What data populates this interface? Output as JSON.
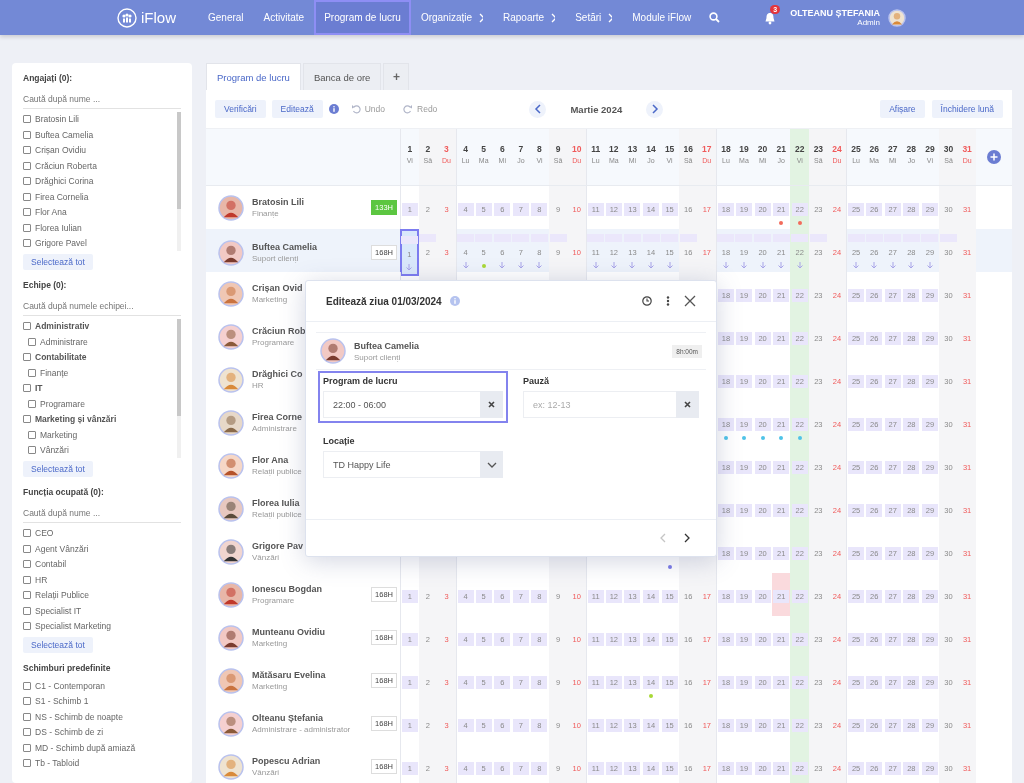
{
  "topbar": {
    "logo": "iFlow",
    "nav": [
      {
        "label": "General",
        "selected": false,
        "submenu": false
      },
      {
        "label": "Activitate",
        "selected": false,
        "submenu": false
      },
      {
        "label": "Program de lucru",
        "selected": true,
        "submenu": false
      },
      {
        "label": "Organizație",
        "selected": false,
        "submenu": true
      },
      {
        "label": "Rapoarte",
        "selected": false,
        "submenu": true
      },
      {
        "label": "Setări",
        "selected": false,
        "submenu": true
      },
      {
        "label": "Module iFlow",
        "selected": false,
        "submenu": false
      }
    ],
    "notifications": "3",
    "user": {
      "name": "OLTEANU ȘTEFANIA",
      "role": "Admin"
    }
  },
  "sidebar": [
    {
      "title": "Angajați (0):",
      "search_placeholder": "Caută după nume ...",
      "scrollable": true,
      "kind": "checklist",
      "select_all": "Selectează tot",
      "items": [
        {
          "label": "Bratosin Lili",
          "checked": false
        },
        {
          "label": "Buftea Camelia",
          "checked": false
        },
        {
          "label": "Crișan Ovidiu",
          "checked": false
        },
        {
          "label": "Crăciun Roberta",
          "checked": false
        },
        {
          "label": "Drăghici Corina",
          "checked": false
        },
        {
          "label": "Firea Cornelia",
          "checked": false
        },
        {
          "label": "Flor Ana",
          "checked": false
        },
        {
          "label": "Florea Iulian",
          "checked": false
        },
        {
          "label": "Grigore Pavel",
          "checked": false
        }
      ]
    },
    {
      "title": "Echipe (0):",
      "search_placeholder": "Caută după numele echipei...",
      "scrollable": true,
      "kind": "tree",
      "select_all": "Selectează tot",
      "items": [
        {
          "label": "Administrativ",
          "checked": false,
          "children": [
            {
              "label": "Administrare",
              "checked": false
            }
          ]
        },
        {
          "label": "Contabilitate",
          "checked": false,
          "children": [
            {
              "label": "Finanțe",
              "checked": false
            }
          ]
        },
        {
          "label": "IT",
          "checked": false,
          "children": [
            {
              "label": "Programare",
              "checked": false
            }
          ]
        },
        {
          "label": "Marketing și vânzări",
          "checked": false,
          "children": [
            {
              "label": "Marketing",
              "checked": false
            },
            {
              "label": "Vânzări",
              "checked": false
            }
          ]
        }
      ]
    },
    {
      "title": "Funcția ocupată (0):",
      "search_placeholder": "Caută după nume ...",
      "scrollable": false,
      "kind": "checklist",
      "select_all": "Selectează tot",
      "items": [
        {
          "label": "CEO",
          "checked": false
        },
        {
          "label": "Agent Vânzări",
          "checked": false
        },
        {
          "label": "Contabil",
          "checked": false
        },
        {
          "label": "HR",
          "checked": false
        },
        {
          "label": "Relații Publice",
          "checked": false
        },
        {
          "label": "Specialist IT",
          "checked": false
        },
        {
          "label": "Specialist Marketing",
          "checked": false
        }
      ]
    },
    {
      "title": "Schimburi predefinite",
      "scrollable": false,
      "kind": "checklist",
      "items": [
        {
          "label": "C1 - Contemporan",
          "checked": false
        },
        {
          "label": "S1 - Schimb 1",
          "checked": false
        },
        {
          "label": "NS - Schimb de noapte",
          "checked": false
        },
        {
          "label": "DS - Schimb de zi",
          "checked": false
        },
        {
          "label": "MD - Schimb după amiază",
          "checked": false
        },
        {
          "label": "Tb - Tabloid",
          "checked": false
        }
      ]
    }
  ],
  "tabs": [
    {
      "label": "Program de lucru",
      "selected": true
    },
    {
      "label": "Banca de ore",
      "selected": false
    }
  ],
  "add_tab": "+",
  "toolbar": {
    "left": [
      {
        "kind": "button",
        "label": "Verificări",
        "disabled": false
      },
      {
        "kind": "button",
        "label": "Editează",
        "disabled": false
      },
      {
        "kind": "info"
      },
      {
        "kind": "undo",
        "label": "Undo",
        "disabled": true
      },
      {
        "kind": "redo",
        "label": "Redo",
        "disabled": true
      }
    ],
    "month": "Martie 2024",
    "right": [
      "Afișare",
      "Închidere lună"
    ]
  },
  "calendar": {
    "days": [
      {
        "num": "1",
        "weekday": "Vi",
        "kind": "weekday",
        "today": false
      },
      {
        "num": "2",
        "weekday": "Sâ",
        "kind": "saturday",
        "today": false
      },
      {
        "num": "3",
        "weekday": "Du",
        "kind": "sunday",
        "today": false
      },
      {
        "num": "4",
        "weekday": "Lu",
        "kind": "weekday",
        "today": false
      },
      {
        "num": "5",
        "weekday": "Ma",
        "kind": "weekday",
        "today": false
      },
      {
        "num": "6",
        "weekday": "Mi",
        "kind": "weekday",
        "today": false
      },
      {
        "num": "7",
        "weekday": "Jo",
        "kind": "weekday",
        "today": false
      },
      {
        "num": "8",
        "weekday": "Vi",
        "kind": "weekday",
        "today": false
      },
      {
        "num": "9",
        "weekday": "Sâ",
        "kind": "saturday",
        "today": false
      },
      {
        "num": "10",
        "weekday": "Du",
        "kind": "sunday",
        "today": false
      },
      {
        "num": "11",
        "weekday": "Lu",
        "kind": "weekday",
        "today": false
      },
      {
        "num": "12",
        "weekday": "Ma",
        "kind": "weekday",
        "today": false
      },
      {
        "num": "13",
        "weekday": "Mi",
        "kind": "weekday",
        "today": false
      },
      {
        "num": "14",
        "weekday": "Jo",
        "kind": "weekday",
        "today": false
      },
      {
        "num": "15",
        "weekday": "Vi",
        "kind": "weekday",
        "today": false
      },
      {
        "num": "16",
        "weekday": "Sâ",
        "kind": "saturday",
        "today": false
      },
      {
        "num": "17",
        "weekday": "Du",
        "kind": "sunday",
        "today": false
      },
      {
        "num": "18",
        "weekday": "Lu",
        "kind": "weekday",
        "today": false
      },
      {
        "num": "19",
        "weekday": "Ma",
        "kind": "weekday",
        "today": false
      },
      {
        "num": "20",
        "weekday": "Mi",
        "kind": "weekday",
        "today": false
      },
      {
        "num": "21",
        "weekday": "Jo",
        "kind": "weekday",
        "today": false
      },
      {
        "num": "22",
        "weekday": "Vi",
        "kind": "weekday",
        "today": true
      },
      {
        "num": "23",
        "weekday": "Sâ",
        "kind": "saturday",
        "today": false
      },
      {
        "num": "24",
        "weekday": "Du",
        "kind": "sunday",
        "today": false
      },
      {
        "num": "25",
        "weekday": "Lu",
        "kind": "weekday",
        "today": false
      },
      {
        "num": "26",
        "weekday": "Ma",
        "kind": "weekday",
        "today": false
      },
      {
        "num": "27",
        "weekday": "Mi",
        "kind": "weekday",
        "today": false
      },
      {
        "num": "28",
        "weekday": "Jo",
        "kind": "weekday",
        "today": false
      },
      {
        "num": "29",
        "weekday": "Vi",
        "kind": "weekday",
        "today": false
      },
      {
        "num": "30",
        "weekday": "Sâ",
        "kind": "saturday",
        "today": false
      },
      {
        "num": "31",
        "weekday": "Du",
        "kind": "sunday",
        "today": false
      }
    ],
    "rows": [
      {
        "name": "Bratosin Lili",
        "team": "Finanțe",
        "hours": "133H",
        "hours_highlighted": true,
        "selected": false,
        "days": [
          "1",
          "2",
          "3",
          "4",
          "5",
          "6",
          "7",
          "8",
          "9",
          "10",
          "11",
          "12",
          "13",
          "14",
          "15",
          "16",
          "17",
          "18",
          "19",
          "20",
          {
            "num": "21",
            "color": "#f26b5b"
          },
          {
            "num": "22",
            "color": "#f26b5b"
          },
          "23",
          "24",
          "25",
          "26",
          "27",
          "28",
          "29",
          "30",
          "31"
        ]
      },
      {
        "name": "Buftea Camelia",
        "team": "Suport clienți",
        "hours": "168H",
        "hours_highlighted": false,
        "selected": true,
        "shift_arrows": true,
        "days": [
          {
            "num": "1",
            "selected": true
          },
          "2",
          "3",
          "4",
          {
            "num": "5",
            "color": "#a8d836"
          },
          "6",
          "7",
          "8",
          "9",
          "10",
          "11",
          "12",
          "13",
          "14",
          "15",
          "16",
          "17",
          "18",
          "19",
          "20",
          "21",
          "22",
          "23",
          "24",
          "25",
          "26",
          "27",
          "28",
          "29",
          "30",
          "31"
        ]
      },
      {
        "name": "Crișan Ovid",
        "team": "Marketing",
        "selected": false,
        "days": [
          "18",
          "19",
          "20",
          "21",
          "22",
          "23",
          "24",
          "25",
          "26",
          "27",
          "28",
          "29",
          "30",
          "31"
        ]
      },
      {
        "name": "Crăciun Rob",
        "team": "Programare",
        "selected": false,
        "days": [
          "18",
          "19",
          "20",
          "21",
          "22",
          "23",
          "24",
          "25",
          "26",
          "27",
          "28",
          "29",
          "30",
          "31"
        ]
      },
      {
        "name": "Drăghici Co",
        "team": "HR",
        "selected": false,
        "days": [
          "18",
          "19",
          "20",
          "21",
          "22",
          "23",
          "24",
          "25",
          "26",
          "27",
          "28",
          "29",
          "30",
          "31"
        ]
      },
      {
        "name": "Firea Corne",
        "team": "Administrare",
        "selected": false,
        "days": [
          {
            "num": "18",
            "color": "#4fc3e8"
          },
          {
            "num": "19",
            "color": "#4fc3e8"
          },
          {
            "num": "20",
            "color": "#4fc3e8"
          },
          {
            "num": "21",
            "color": "#4fc3e8"
          },
          {
            "num": "22",
            "color": "#4fc3e8"
          },
          "23",
          "24",
          "25",
          "26",
          "27",
          "28",
          "29",
          "30",
          "31"
        ]
      },
      {
        "name": "Flor Ana",
        "team": "Relații publice",
        "selected": false,
        "days": [
          "18",
          "19",
          "20",
          "21",
          "22",
          "23",
          "24",
          "25",
          "26",
          "27",
          "28",
          "29",
          "30",
          "31"
        ]
      },
      {
        "name": "Florea Iulia",
        "team": "Relații publice",
        "selected": false,
        "days": [
          "18",
          "19",
          "20",
          "21",
          "22",
          "23",
          "24",
          "25",
          "26",
          "27",
          "28",
          "29",
          "30",
          "31"
        ]
      },
      {
        "name": "Grigore Pav",
        "team": "Vânzări",
        "selected": false,
        "days": [
          {
            "covered": true,
            "color": "#7b7be8"
          },
          {
            "covered": true
          },
          {
            "covered": true
          },
          "18",
          "19",
          "20",
          "21",
          "22",
          "23",
          "24",
          "25",
          "26",
          "27",
          "28",
          "29",
          "30",
          "31"
        ]
      },
      {
        "name": "Ionescu Bogdan",
        "team": "Programare",
        "hours": "168H",
        "hours_highlighted": false,
        "selected": false,
        "days": [
          "1",
          "2",
          "3",
          "4",
          "5",
          "6",
          "7",
          "8",
          "9",
          "10",
          "11",
          "12",
          "13",
          "14",
          "15",
          "16",
          "17",
          "18",
          "19",
          "20",
          {
            "num": "21",
            "absent": true
          },
          "22",
          "23",
          "24",
          "25",
          "26",
          "27",
          "28",
          "29",
          "30",
          "31"
        ]
      },
      {
        "name": "Munteanu Ovidiu",
        "team": "Marketing",
        "hours": "168H",
        "hours_highlighted": false,
        "selected": false,
        "days": [
          "1",
          "2",
          "3",
          "4",
          "5",
          "6",
          "7",
          "8",
          "9",
          "10",
          "11",
          "12",
          "13",
          "14",
          "15",
          "16",
          "17",
          "18",
          "19",
          "20",
          "21",
          "22",
          "23",
          "24",
          "25",
          "26",
          "27",
          "28",
          "29",
          "30",
          "31"
        ]
      },
      {
        "name": "Mătăsaru Evelina",
        "team": "Marketing",
        "hours": "168H",
        "hours_highlighted": false,
        "selected": false,
        "days": [
          "1",
          "2",
          "3",
          "4",
          "5",
          "6",
          "7",
          "8",
          "9",
          "10",
          "11",
          "12",
          "13",
          {
            "num": "14",
            "color": "#a8d836"
          },
          "15",
          "16",
          "17",
          "18",
          "19",
          "20",
          "21",
          "22",
          "23",
          "24",
          "25",
          "26",
          "27",
          "28",
          "29",
          "30",
          "31"
        ]
      },
      {
        "name": "Olteanu Ștefania",
        "team": "Administrare - administrator",
        "hours": "168H",
        "hours_highlighted": false,
        "selected": false,
        "days": [
          "1",
          "2",
          "3",
          "4",
          "5",
          "6",
          "7",
          "8",
          "9",
          "10",
          "11",
          "12",
          "13",
          "14",
          "15",
          "16",
          "17",
          "18",
          "19",
          "20",
          "21",
          "22",
          "23",
          "24",
          "25",
          "26",
          "27",
          "28",
          "29",
          "30",
          "31"
        ]
      },
      {
        "name": "Popescu Adrian",
        "team": "Vânzări",
        "hours": "168H",
        "hours_highlighted": false,
        "selected": false,
        "days": [
          "1",
          "2",
          "3",
          "4",
          "5",
          "6",
          "7",
          "8",
          "9",
          "10",
          "11",
          "12",
          "13",
          "14",
          "15",
          "16",
          "17",
          "18",
          "19",
          "20",
          "21",
          "22",
          "23",
          "24",
          "25",
          "26",
          "27",
          "28",
          "29",
          "30",
          "31"
        ]
      }
    ]
  },
  "dialog": {
    "title": "Editează ziua 01/03/2024",
    "person": {
      "name": "Buftea Camelia",
      "team": "Suport clienți",
      "duration": "8h:00m"
    },
    "fields": [
      {
        "kind": "text",
        "label": "Program de lucru",
        "value": "22:00 - 06:00",
        "focused": true
      },
      {
        "kind": "text",
        "label": "Pauză",
        "placeholder": "ex: 12-13",
        "focused": false
      },
      {
        "kind": "select",
        "label": "Locație",
        "value": "TD Happy Life",
        "focused": false
      }
    ],
    "prev_disabled": true,
    "next_disabled": false
  }
}
